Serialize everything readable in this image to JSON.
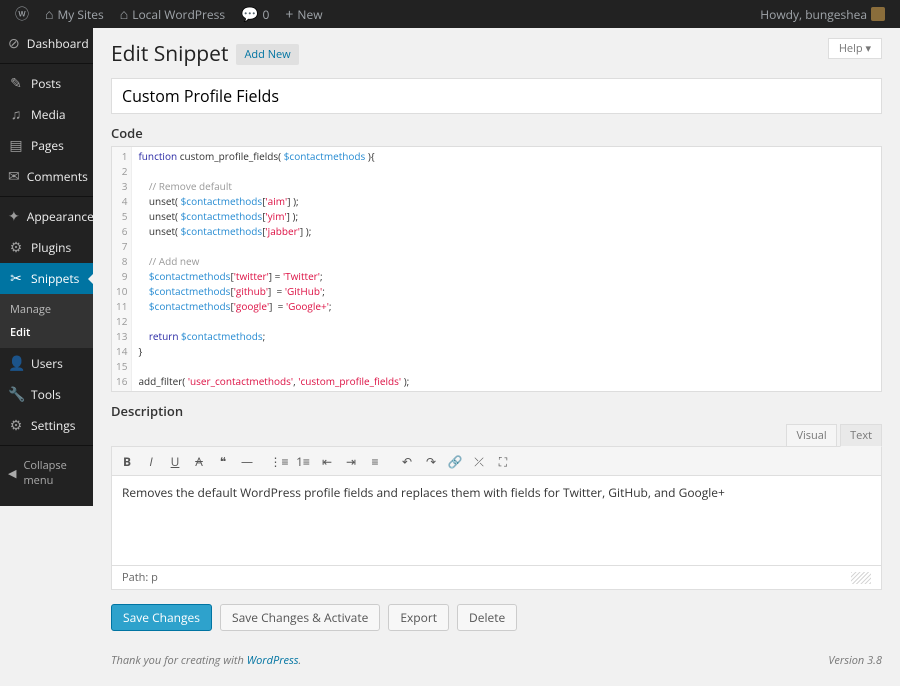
{
  "adminbar": {
    "mysites": "My Sites",
    "sitename": "Local WordPress",
    "comments": "0",
    "new": "New",
    "howdy": "Howdy, bungeshea"
  },
  "help": "Help ▾",
  "sidebar": {
    "dashboard": "Dashboard",
    "posts": "Posts",
    "media": "Media",
    "pages": "Pages",
    "comments": "Comments",
    "appearance": "Appearance",
    "plugins": "Plugins",
    "snippets": "Snippets",
    "snippets_sub": {
      "manage": "Manage",
      "edit": "Edit"
    },
    "users": "Users",
    "tools": "Tools",
    "settings": "Settings",
    "collapse": "Collapse menu"
  },
  "page": {
    "title": "Edit Snippet",
    "addnew": "Add New"
  },
  "snippet": {
    "title": "Custom Profile Fields"
  },
  "labels": {
    "code": "Code",
    "description": "Description"
  },
  "code": {
    "l1a": "function",
    "l1b": " custom_profile_fields( ",
    "l1c": "$contactmethods",
    "l1d": " ){",
    "l3": "// Remove default",
    "l4a": "unset( ",
    "l4b": "$contactmethods",
    "l4c": "[",
    "l4d": "'aim'",
    "l4e": "] );",
    "l5a": "unset( ",
    "l5b": "$contactmethods",
    "l5c": "[",
    "l5d": "'yim'",
    "l5e": "] );",
    "l6a": "unset( ",
    "l6b": "$contactmethods",
    "l6c": "[",
    "l6d": "'jabber'",
    "l6e": "] );",
    "l8": "// Add new",
    "l9a": "$contactmethods",
    "l9b": "[",
    "l9c": "'twitter'",
    "l9d": "] = ",
    "l9e": "'Twitter'",
    "l9f": ";",
    "l10a": "$contactmethods",
    "l10b": "[",
    "l10c": "'github'",
    "l10d": "]  = ",
    "l10e": "'GitHub'",
    "l10f": ";",
    "l11a": "$contactmethods",
    "l11b": "[",
    "l11c": "'google'",
    "l11d": "]  = ",
    "l11e": "'Google+'",
    "l11f": ";",
    "l13a": "return ",
    "l13b": "$contactmethods",
    "l13c": ";",
    "l14": "}",
    "l16a": "add_filter( ",
    "l16b": "'user_contactmethods'",
    "l16c": ", ",
    "l16d": "'custom_profile_fields'",
    "l16e": " );"
  },
  "lines": [
    "1",
    "2",
    "3",
    "4",
    "5",
    "6",
    "7",
    "8",
    "9",
    "10",
    "11",
    "12",
    "13",
    "14",
    "15",
    "16"
  ],
  "editor": {
    "visual": "Visual",
    "text": "Text",
    "content": "Removes the default WordPress profile fields and replaces them with fields for Twitter, GitHub, and Google+",
    "path": "Path: p"
  },
  "buttons": {
    "save": "Save Changes",
    "activate": "Save Changes & Activate",
    "export": "Export",
    "delete": "Delete"
  },
  "footer": {
    "thank": "Thank you for creating with ",
    "wp": "WordPress",
    "dot": ".",
    "version": "Version 3.8"
  }
}
